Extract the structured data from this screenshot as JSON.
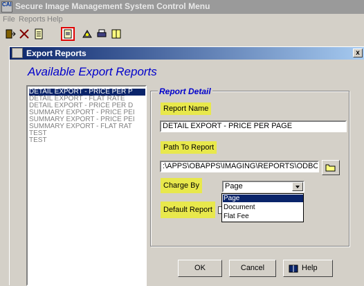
{
  "app": {
    "icon_text": "CAI",
    "title": "Secure Image Management System Control Menu"
  },
  "menu": [
    "File",
    "Reports",
    "Help"
  ],
  "toolbar": [
    {
      "name": "exit-icon"
    },
    {
      "name": "tools-icon"
    },
    {
      "name": "document-icon"
    },
    {
      "name": "export-reports-icon",
      "selected": true
    },
    {
      "name": "image-icon"
    },
    {
      "name": "printer-icon"
    },
    {
      "name": "book-icon"
    }
  ],
  "dialog": {
    "title": "Export Reports",
    "close_label": "x",
    "heading": "Available Export Reports",
    "reports": [
      "DETAIL EXPORT - PRICE PER P",
      "DETAIL EXPORT - FLAT RATE",
      "DETAIL EXPORT - PRICE PER D",
      "SUMMARY EXPORT - PRICE PEI",
      "SUMMARY EXPORT - PRICE PEI",
      "SUMMARY EXPORT - FLAT RAT",
      "TEST",
      "TEST"
    ],
    "selected_report_index": 0,
    "detail": {
      "group_title": "Report Detail",
      "report_name_label": "Report Name",
      "report_name_value": "DETAIL EXPORT - PRICE PER PAGE",
      "path_label": "Path To Report",
      "path_value": ":\\APPS\\OBAPPS\\IMAGING\\REPORTS\\ODBC",
      "charge_by_label": "Charge By",
      "charge_by_value": "Page",
      "charge_by_options": [
        "Page",
        "Document",
        "Flat Fee"
      ],
      "default_report_label": "Default Report"
    },
    "buttons": {
      "ok": "OK",
      "cancel": "Cancel",
      "help": "Help"
    }
  },
  "colors": {
    "highlight": "#e8e84c",
    "accent_blue": "#0000cc",
    "selection": "#0a246a"
  }
}
